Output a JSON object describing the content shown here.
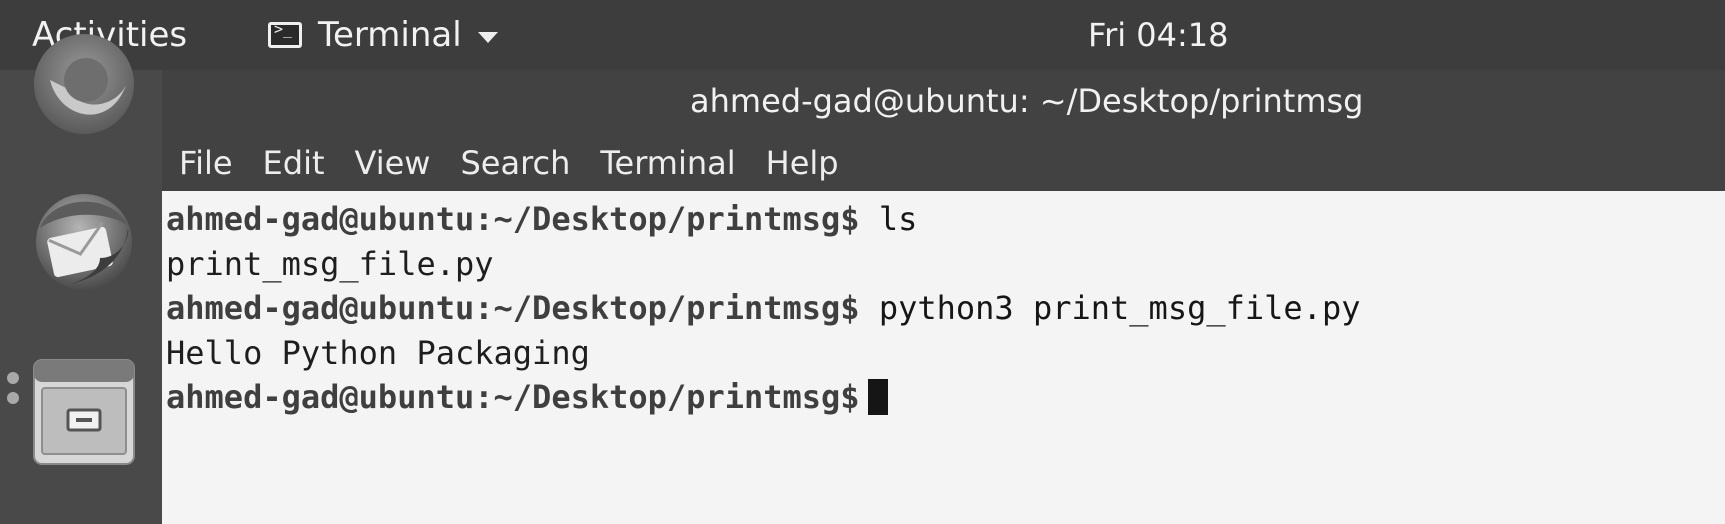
{
  "topbar": {
    "activities_label": "Activities",
    "app_menu_label": "Terminal",
    "app_menu_icon": "terminal-app-icon",
    "clock": "Fri 04:18"
  },
  "dock": {
    "items": [
      {
        "icon": "browser-icon"
      },
      {
        "icon": "mail-icon"
      },
      {
        "icon": "files-icon",
        "running": true
      }
    ]
  },
  "window": {
    "title": "ahmed-gad@ubuntu: ~/Desktop/printmsg",
    "menu": [
      "File",
      "Edit",
      "View",
      "Search",
      "Terminal",
      "Help"
    ]
  },
  "terminal": {
    "lines": [
      {
        "prompt": "ahmed-gad@ubuntu:~/Desktop/printmsg$",
        "command": " ls"
      },
      {
        "output": "print_msg_file.py"
      },
      {
        "prompt": "ahmed-gad@ubuntu:~/Desktop/printmsg$",
        "command": " python3 print_msg_file.py"
      },
      {
        "output": "Hello Python Packaging"
      },
      {
        "prompt": "ahmed-gad@ubuntu:~/Desktop/printmsg$",
        "command": ""
      }
    ]
  },
  "colors": {
    "topbar_bg": "#3d3d3d",
    "dock_bg": "#494949",
    "window_chrome": "#424242",
    "terminal_bg": "#f4f4f4"
  }
}
